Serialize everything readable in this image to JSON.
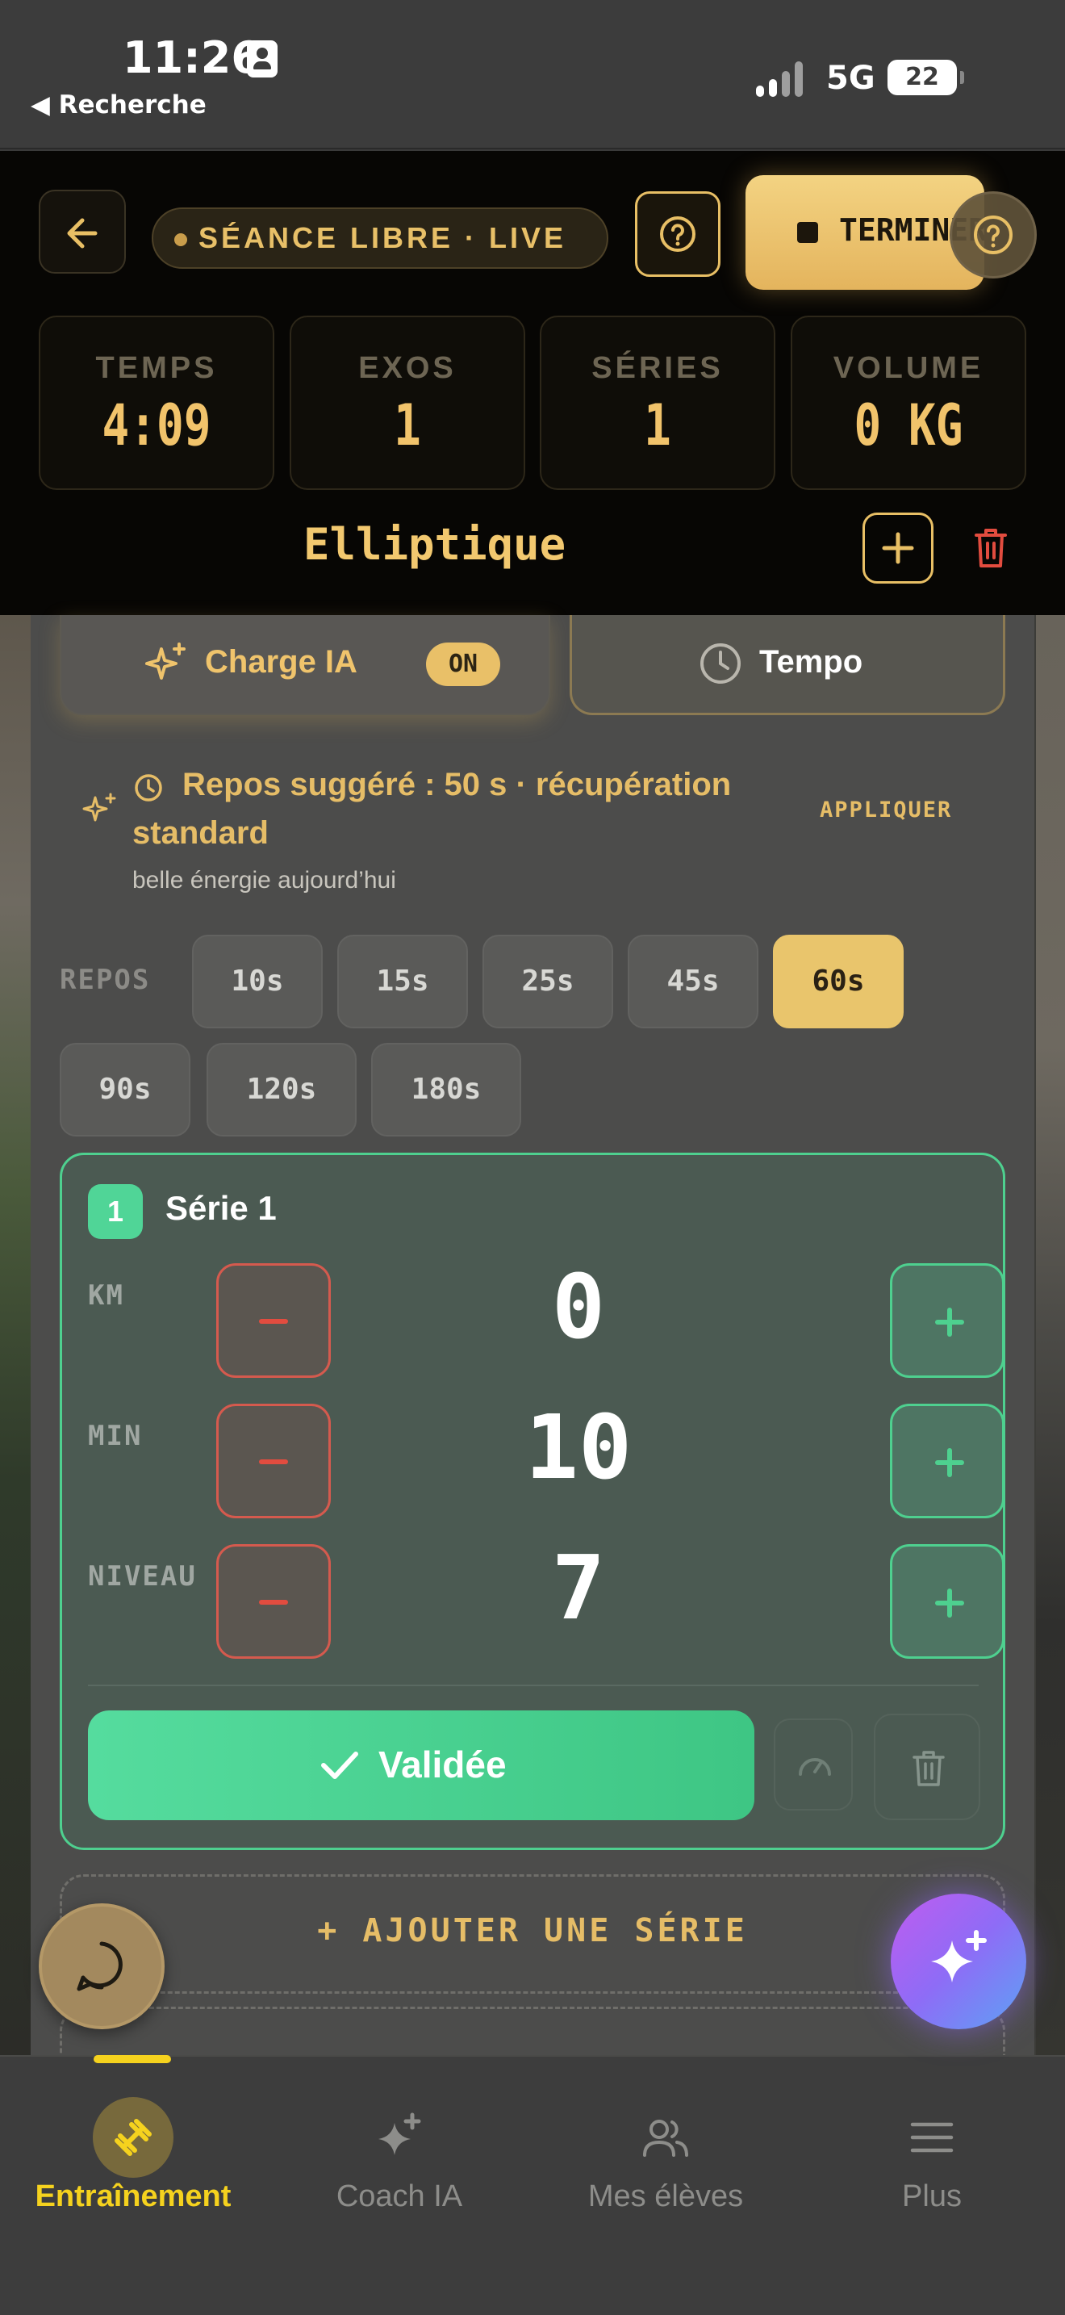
{
  "status_bar": {
    "time": "11:26",
    "back_label": "◀ Recherche",
    "network": "5G",
    "battery": "22"
  },
  "session": {
    "live_label": "SÉANCE LIBRE · LIVE",
    "finish_label": "TERMINER",
    "stats": [
      {
        "label": "TEMPS",
        "value": "4:09"
      },
      {
        "label": "EXOS",
        "value": "1"
      },
      {
        "label": "SÉRIES",
        "value": "1"
      },
      {
        "label": "VOLUME",
        "value": "0 KG"
      }
    ],
    "exercise_title": "Elliptique"
  },
  "toggles": {
    "ai_load_label": "Charge IA",
    "ai_load_badge": "ON",
    "tempo_label": "Tempo"
  },
  "rest_suggestion": {
    "text": "Repos suggéré : 50 s · récupération standard",
    "subtext": "belle énergie aujourd’hui",
    "apply_label": "APPLIQUER"
  },
  "rest_picker": {
    "label": "REPOS",
    "options": [
      "10s",
      "15s",
      "25s",
      "45s",
      "60s",
      "90s",
      "120s",
      "180s"
    ],
    "selected": "60s"
  },
  "set": {
    "number": "1",
    "title": "Série 1",
    "rows": [
      {
        "label": "KM",
        "value": "0"
      },
      {
        "label": "MIN",
        "value": "10"
      },
      {
        "label": "NIVEAU",
        "value": "7"
      }
    ],
    "validated_label": "Validée"
  },
  "add_series_label": "+ AJOUTER UNE SÉRIE",
  "tabs": [
    {
      "label": "Entraînement",
      "icon": "dumbbell-icon",
      "active": true
    },
    {
      "label": "Coach IA",
      "icon": "sparkles-icon",
      "active": false
    },
    {
      "label": "Mes élèves",
      "icon": "users-icon",
      "active": false
    },
    {
      "label": "Plus",
      "icon": "menu-icon",
      "active": false
    }
  ],
  "colors": {
    "accent_gold": "#e9c56c",
    "success_green": "#4ed08f",
    "danger_red": "#e24c3f",
    "tab_active": "#f5d21e"
  }
}
